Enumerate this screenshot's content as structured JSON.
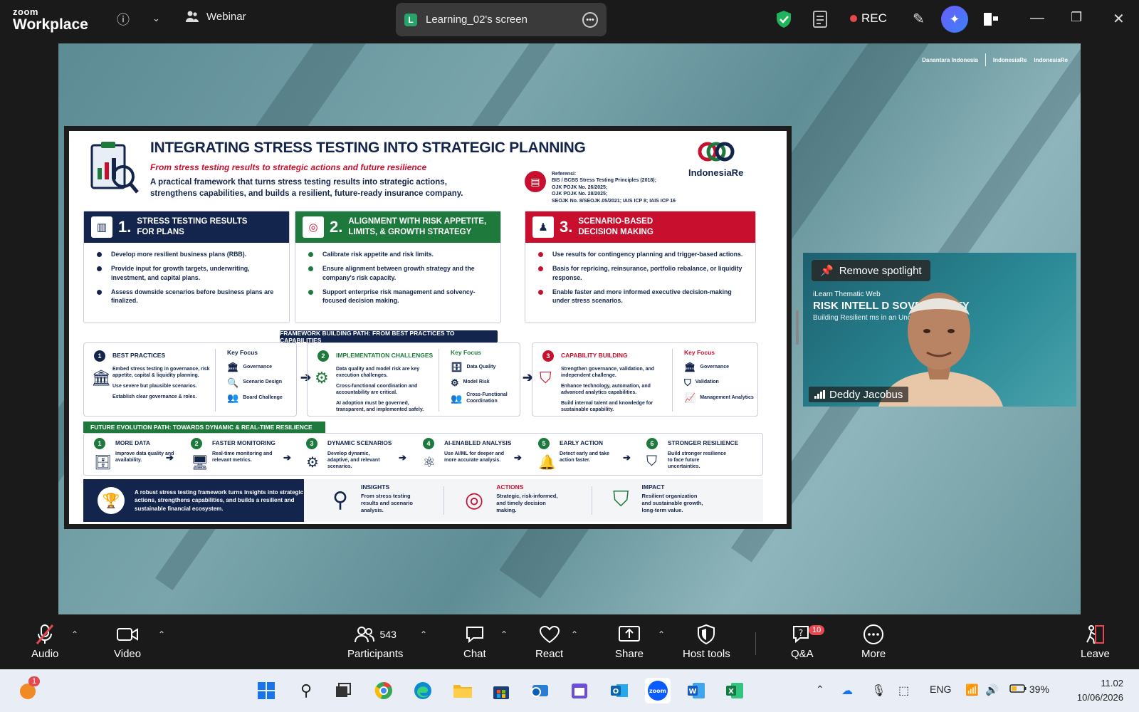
{
  "topbar": {
    "logo_top": "zoom",
    "logo_bottom": "Workplace",
    "meeting_type": "Webinar",
    "share_title": "Learning_02's screen",
    "share_initial": "L",
    "rec_label": "REC"
  },
  "share": {
    "brand_1": "Danantara Indonesia",
    "brand_2": "IndonesiaRe",
    "brand_3": "IndonesiaRe"
  },
  "slide": {
    "title": "INTEGRATING STRESS TESTING INTO STRATEGIC PLANNING",
    "subtitle": "From stress testing results to strategic actions and future resilience",
    "desc": "A practical framework that turns stress testing results into strategic actions, strengthens capabilities, and builds a resilient, future-ready insurance company.",
    "ref_title": "Referensi:",
    "refs": [
      "BIS / BCBS Stress Testing Principles (2018);",
      "OJK POJK No. 26/2025;",
      "OJK POJK No. 28/2025;",
      "SEOJK No. 8/SEOJK.05/2021; IAIS ICP 8; IAIS ICP 16"
    ],
    "logo_text": "IndonesiaRe",
    "pillars": [
      {
        "num": "1.",
        "label_1": "STRESS TESTING RESULTS",
        "label_2": "FOR PLANS",
        "color": "#14254d",
        "items": [
          "Develop more resilient business plans (RBB).",
          "Provide input for growth targets, underwriting, investment, and capital plans.",
          "Assess downside scenarios before business plans are finalized."
        ]
      },
      {
        "num": "2.",
        "label_1": "ALIGNMENT WITH RISK APPETITE,",
        "label_2": "LIMITS, & GROWTH STRATEGY",
        "color": "#1e7a3c",
        "items": [
          "Calibrate risk appetite and risk limits.",
          "Ensure alignment between growth strategy and the company's risk capacity.",
          "Support enterprise risk management and solvency-focused decision making."
        ]
      },
      {
        "num": "3.",
        "label_1": "SCENARIO-BASED",
        "label_2": "DECISION MAKING",
        "color": "#c8102e",
        "items": [
          "Use results for contingency planning and trigger-based actions.",
          "Basis for repricing, reinsurance, portfolio rebalance, or liquidity response.",
          "Enable faster and more informed executive decision-making under stress scenarios."
        ]
      }
    ],
    "framework_label": "FRAMEWORK BUILDING PATH: FROM BEST PRACTICES TO CAPABILITIES",
    "key_focus_label": "Key Focus",
    "steps": [
      {
        "num": "1",
        "title": "BEST PRACTICES",
        "color": "#14254d",
        "items": [
          "Embed stress testing in governance, risk appetite, capital & liquidity planning.",
          "Use severe but plausible scenarios.",
          "Establish clear governance & roles."
        ],
        "focus": [
          "Governance",
          "Scenario Design",
          "Board Challenge"
        ]
      },
      {
        "num": "2",
        "title": "IMPLEMENTATION CHALLENGES",
        "color": "#1e7a3c",
        "items": [
          "Data quality and model risk are key execution challenges.",
          "Cross-functional coordination and accountability are critical.",
          "AI adoption must be governed, transparent, and implemented safely."
        ],
        "focus": [
          "Data Quality",
          "Model Risk",
          "Cross-Functional Coordination"
        ]
      },
      {
        "num": "3",
        "title": "CAPABILITY BUILDING",
        "color": "#c8102e",
        "items": [
          "Strengthen governance, validation, and independent challenge.",
          "Enhance technology, automation, and advanced analytics capabilities.",
          "Build internal talent and knowledge for sustainable capability."
        ],
        "focus": [
          "Governance",
          "Validation",
          "Management Analytics"
        ]
      }
    ],
    "future_label": "FUTURE EVOLUTION PATH: TOWARDS DYNAMIC & REAL-TIME RESILIENCE",
    "future": [
      {
        "num": "1",
        "title": "MORE DATA",
        "text": "Improve data quality and availability."
      },
      {
        "num": "2",
        "title": "FASTER MONITORING",
        "text": "Real-time monitoring and relevant metrics."
      },
      {
        "num": "3",
        "title": "DYNAMIC SCENARIOS",
        "text": "Develop dynamic, adaptive, and relevant scenarios."
      },
      {
        "num": "4",
        "title": "AI-ENABLED ANALYSIS",
        "text": "Use AI/ML for deeper and more accurate analysis."
      },
      {
        "num": "5",
        "title": "EARLY ACTION",
        "text": "Detect early and take action faster."
      },
      {
        "num": "6",
        "title": "STRONGER RESILIENCE",
        "text": "Build stronger resilience to face future uncertainties."
      }
    ],
    "bottom_statement": "A robust stress testing framework turns insights into strategic actions, strengthens capabilities, and builds a resilient and sustainable financial ecosystem.",
    "outcomes": [
      {
        "title": "INSIGHTS",
        "text": "From stress testing results and scenario analysis."
      },
      {
        "title": "ACTIONS",
        "text": "Strategic, risk-informed, and timely decision making."
      },
      {
        "title": "IMPACT",
        "text": "Resilient organization and sustainable growth, long-term value."
      }
    ]
  },
  "spotlight": {
    "remove_label": "Remove spotlight",
    "bg_line1": "iLearn Thematic Web",
    "bg_line2": "RISK INTELL        D SOVEREIGNTY",
    "bg_line3": "Building Resilient              ms in an Uncertain World",
    "speaker_name": "Deddy Jacobus"
  },
  "controls": {
    "audio": "Audio",
    "video": "Video",
    "participants": "Participants",
    "participants_count": "543",
    "chat": "Chat",
    "react": "React",
    "share": "Share",
    "host_tools": "Host tools",
    "qa": "Q&A",
    "qa_badge": "10",
    "more": "More",
    "leave": "Leave"
  },
  "taskbar": {
    "notif_badge": "1",
    "lang": "ENG",
    "battery": "39%",
    "time": "11.02",
    "date": "10/06/2026"
  }
}
